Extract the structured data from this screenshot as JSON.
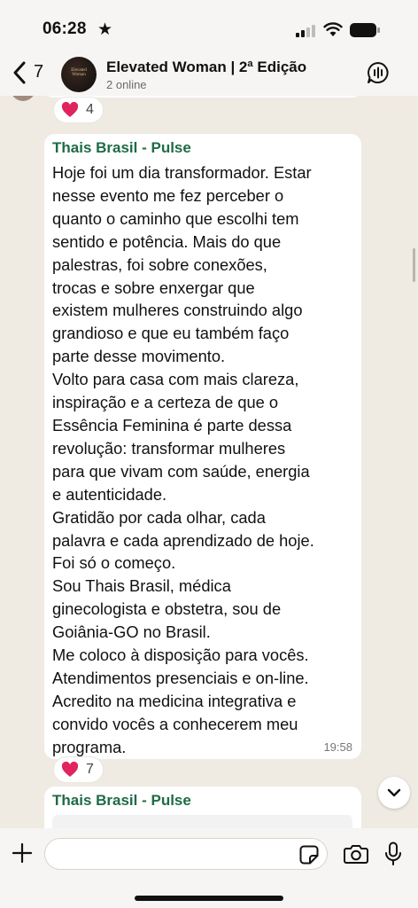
{
  "status_bar": {
    "time": "06:28",
    "star": "★"
  },
  "header": {
    "back_count": "7",
    "title": "Elevated Woman | 2ª Edição",
    "subtitle": "2 online",
    "avatar_text": "Elevated Woman"
  },
  "messages": [
    {
      "sender": "Thais Brasil - Pulse",
      "text": "Hoje foi um dia transformador. Estar\nnesse evento me fez perceber o\nquanto o caminho que escolhi tem\nsentido e potência. Mais do que\npalestras, foi sobre conexões,\ntrocas e sobre enxergar que\nexistem mulheres construindo algo\ngrandioso e que eu também faço\nparte desse movimento.\nVolto para casa com mais clareza,\ninspiração e a certeza de que o\nEssência Feminina é parte dessa\nrevolução: transformar mulheres\npara que vivam com saúde, energia\ne autenticidade.\nGratidão por cada olhar, cada\npalavra e cada aprendizado de hoje.\nFoi só o começo.\nSou Thais Brasil, médica\nginecologista e obstetra, sou de\nGoiânia-GO no Brasil.\nMe coloco à disposição para vocês.\nAtendimentos presenciais e on-line.\nAcredito na medicina integrativa e\nconvido vocês a conhecerem meu\nprograma.",
      "time": "19:58"
    },
    {
      "sender": "Thais Brasil - Pulse"
    }
  ],
  "reactions": [
    {
      "emoji": "heart",
      "count": "4"
    },
    {
      "emoji": "heart",
      "count": "7"
    }
  ],
  "composer": {
    "placeholder": ""
  },
  "colors": {
    "sender": "#1e6b45",
    "background": "#efeae2",
    "heart": "#e0245e"
  }
}
